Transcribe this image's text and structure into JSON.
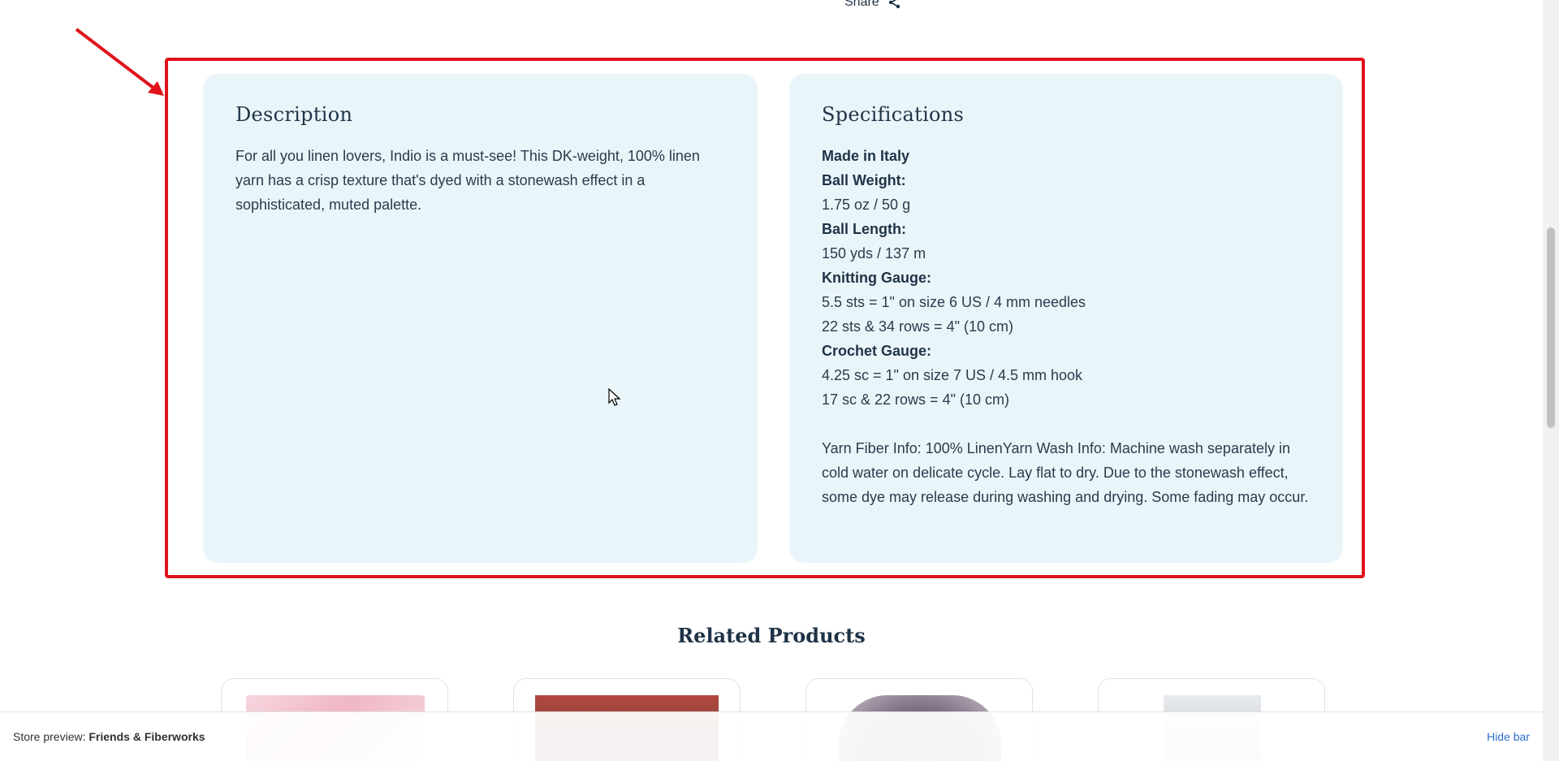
{
  "share": {
    "label": "Share",
    "icon": "share-icon"
  },
  "description": {
    "title": "Description",
    "text": "For all you linen lovers, Indio is a must-see! This DK-weight, 100% linen yarn has a crisp texture that's dyed with a stonewash effect in a sophisticated, muted palette."
  },
  "specifications": {
    "title": "Specifications",
    "made_in": "Made in Italy",
    "ball_weight_label": "Ball Weight:",
    "ball_weight_value": "1.75 oz / 50 g",
    "ball_length_label": "Ball Length:",
    "ball_length_value": "150 yds / 137 m",
    "knitting_gauge_label": "Knitting Gauge:",
    "knitting_gauge_line1": "5.5 sts = 1\" on size 6 US / 4 mm needles",
    "knitting_gauge_line2": "22 sts & 34 rows = 4\" (10 cm)",
    "crochet_gauge_label": "Crochet Gauge:",
    "crochet_gauge_line1": "4.25 sc = 1\" on  size 7 US / 4.5 mm hook",
    "crochet_gauge_line2": "17 sc & 22 rows = 4\" (10 cm)",
    "fiber_wash_info": "Yarn Fiber Info: 100% LinenYarn Wash Info: Machine wash separately in cold water on delicate cycle. Lay flat to dry. Due to the stonewash effect, some dye may release during washing and drying. Some fading may occur."
  },
  "related": {
    "title": "Related Products"
  },
  "preview_bar": {
    "prefix": "Store preview: ",
    "store_name": "Friends & Fiberworks",
    "hide_label": "Hide bar"
  },
  "colors": {
    "panel_bg": "#eaf5fa",
    "annotation_red": "#e0131a",
    "text_dark": "#1f3347",
    "link_blue": "#2c6ecb"
  }
}
